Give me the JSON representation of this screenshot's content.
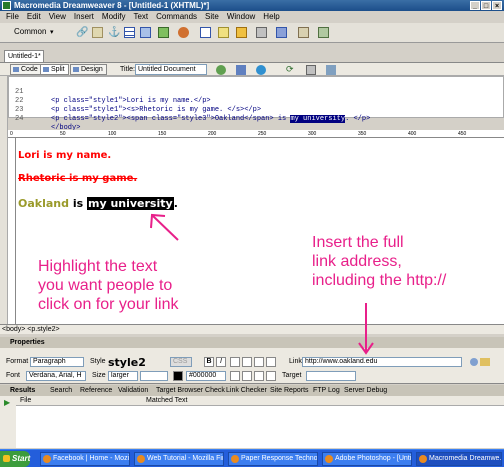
{
  "window": {
    "title": "Macromedia Dreamweaver 8 - [Untitled-1 (XHTML)*]",
    "controls": [
      "_",
      "□",
      "×"
    ]
  },
  "menu": [
    "File",
    "Edit",
    "View",
    "Insert",
    "Modify",
    "Text",
    "Commands",
    "Site",
    "Window",
    "Help"
  ],
  "insert_bar": {
    "category": "Common"
  },
  "document": {
    "tab": "Untitled-1*",
    "views": [
      "Code",
      "Split",
      "Design"
    ],
    "title_label": "Title:",
    "title_value": "Untitled Document"
  },
  "code": {
    "lines": [
      {
        "num": "21",
        "pre": "<p class=\"style1\">Lori is my name.</p>",
        "hl": "",
        "post": ""
      },
      {
        "num": "22",
        "pre": "<p class=\"style1\"><s>Rhetoric is my game. </s></p>",
        "hl": "",
        "post": ""
      },
      {
        "num": "23",
        "pre": "<p class=\"style2\"><span class=\"style3\">Oakland</span> is ",
        "hl": "my university",
        "post": ". </p>"
      },
      {
        "num": "24",
        "pre": "</body>",
        "hl": "",
        "post": ""
      }
    ]
  },
  "ruler": [
    "0",
    "50",
    "100",
    "150",
    "200",
    "250",
    "300",
    "350",
    "400",
    "450"
  ],
  "design": {
    "line1": "Lori is my name.",
    "line2": "Rhetoric is my game.",
    "line3_oakland": "Oakland",
    "line3_is": " is ",
    "line3_selected": "my university",
    "line3_end": "."
  },
  "annotations": {
    "left": [
      "Highlight the text",
      "you want people to",
      "click on for your link"
    ],
    "right": [
      "Insert the full",
      "link address,",
      "including the http://"
    ]
  },
  "status": {
    "tag_path": "<body> <p.style2>"
  },
  "properties": {
    "header": "Properties",
    "format_label": "Format",
    "format_value": "Paragraph",
    "style_label": "Style",
    "style_value": "style2",
    "css_button": "CSS",
    "link_label": "Link",
    "link_value": "http://www.oakland.edu",
    "font_label": "Font",
    "font_value": "Verdana, Arial, H",
    "size_label": "Size",
    "size_value": "larger",
    "color_value": "#000000",
    "target_label": "Target",
    "bold": "B",
    "italic": "I"
  },
  "results": {
    "header": "Results",
    "tabs": [
      "Search",
      "Reference",
      "Validation",
      "Target Browser Check",
      "Link Checker",
      "Site Reports",
      "FTP Log",
      "Server Debug"
    ],
    "col_file": "File",
    "col_matched": "Matched Text"
  },
  "taskbar": {
    "start": "Start",
    "items": [
      "Facebook | Home - Mozill...",
      "Web Tutorial - Mozilla Fir...",
      "Paper Response Technol...",
      "Adobe Photoshop - [Unti...",
      "Macromedia Dreamwe..."
    ]
  },
  "colors": {
    "annotation": "#e8208a",
    "red_text": "#ff0000",
    "oakland": "#9a9a2a",
    "taskbar": "#245edb"
  }
}
